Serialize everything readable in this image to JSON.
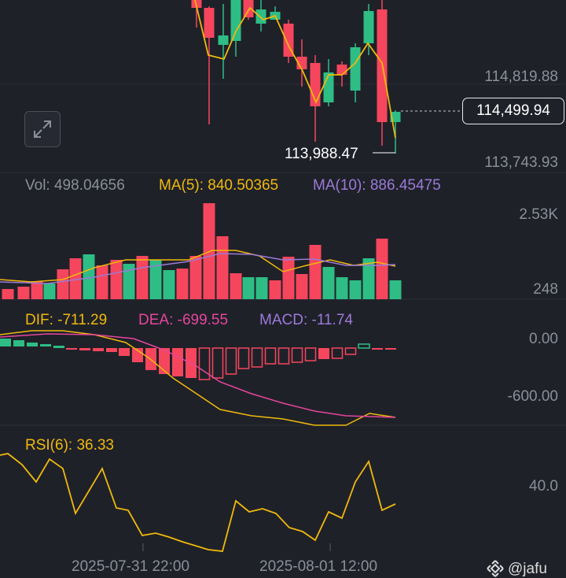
{
  "price": {
    "axis_labels": [
      "114,819.88",
      "113,743.93"
    ],
    "current": "114,499.94",
    "low_marker": "113,988.47"
  },
  "volume": {
    "vol_text": "Vol: 498.04656",
    "ma5_text": "MA(5): 840.50365",
    "ma10_text": "MA(10): 886.45475",
    "axis_labels": [
      "2.53K",
      "248"
    ]
  },
  "macd": {
    "dif_text": "DIF: -711.29",
    "dea_text": "DEA: -699.55",
    "macd_text": "MACD: -11.74",
    "axis_labels": [
      "0.00",
      "-600.00"
    ]
  },
  "rsi": {
    "rsi_text": "RSI(6): 36.33",
    "axis_label": "40.0"
  },
  "x_axis": {
    "labels": [
      "2025-07-31 22:00",
      "2025-08-01 12:00"
    ]
  },
  "watermark": {
    "text": "@jafu",
    "icon": "binance-logo-icon"
  },
  "colors": {
    "up": "#2ebd85",
    "down": "#f6465d",
    "ma5": "#f0b90b",
    "ma10": "#9b7ad8",
    "dea": "#e5469c",
    "background": "#1f2129"
  }
}
